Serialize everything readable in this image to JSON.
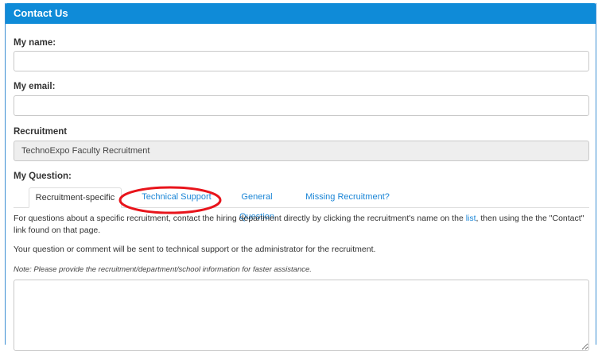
{
  "panel": {
    "title": "Contact Us"
  },
  "form": {
    "name_label": "My name:",
    "name_value": "",
    "email_label": "My email:",
    "email_value": "",
    "recruitment_label": "Recruitment",
    "recruitment_value": "TechnoExpo Faculty Recruitment",
    "question_label": "My Question:",
    "question_value": ""
  },
  "tabs": [
    {
      "label": "Recruitment-specific",
      "active": true
    },
    {
      "label": "Technical Support",
      "active": false,
      "highlighted": true
    },
    {
      "label": "General Question",
      "active": false
    },
    {
      "label": "Missing Recruitment?",
      "active": false
    }
  ],
  "content": {
    "para1_before_link": "For questions about a specific recruitment, contact the hiring department directly by clicking the recruitment's name on the ",
    "para1_link": "list",
    "para1_after_link": ", then using the the \"Contact\" link found on that page.",
    "para2": "Your question or comment will be sent to technical support or the administrator for the recruitment.",
    "note": "Note: Please provide the recruitment/department/school information for faster assistance."
  },
  "colors": {
    "header_bg": "#0f8bd8",
    "link": "#1a85d6",
    "annotation": "#e8141b"
  }
}
